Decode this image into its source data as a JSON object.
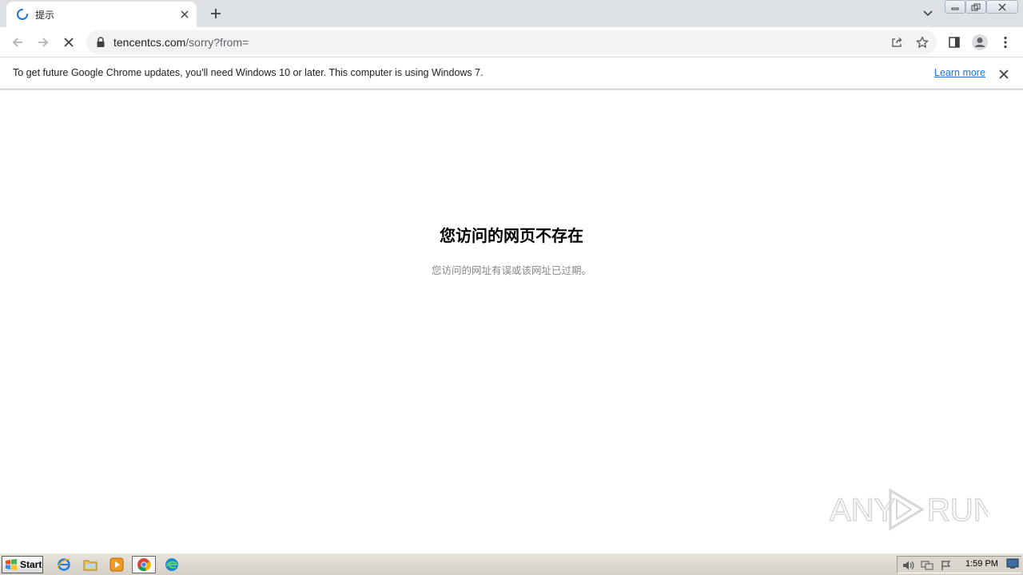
{
  "browser": {
    "tab": {
      "title": "提示",
      "loading": true
    },
    "new_tab_icon": "plus-icon",
    "omnibox": {
      "host": "tencentcs.com",
      "path": "/sorry?from=",
      "secure_icon": "lock-icon"
    }
  },
  "infobar": {
    "message": "To get future Google Chrome updates, you'll need Windows 10 or later. This computer is using Windows 7.",
    "link_label": "Learn more"
  },
  "page": {
    "title": "您访问的网页不存在",
    "description": "您访问的网址有误或该网址已过期。"
  },
  "watermark": {
    "text": "ANY RUN"
  },
  "taskbar": {
    "start_label": "Start",
    "clock": "1:59 PM",
    "apps": [
      "internet-explorer-icon",
      "file-explorer-icon",
      "media-player-icon",
      "chrome-icon",
      "edge-icon"
    ]
  },
  "colors": {
    "tabstrip": "#dee1e6",
    "link": "#1a73e8",
    "spinner": "#1a73e8",
    "description": "#888888"
  }
}
